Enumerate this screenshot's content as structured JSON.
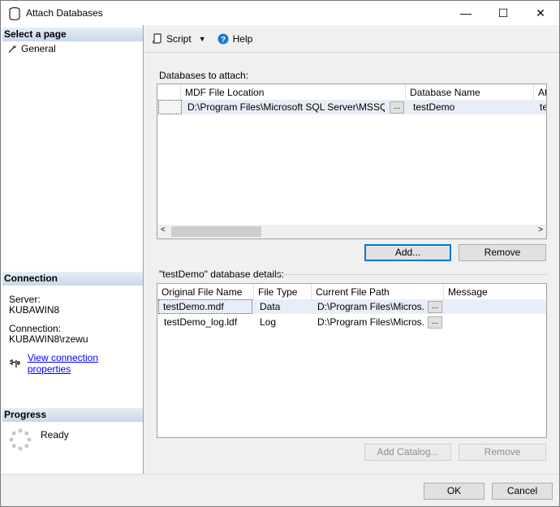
{
  "window": {
    "title": "Attach Databases",
    "minimize": "—",
    "maximize": "☐",
    "close": "✕"
  },
  "left": {
    "select_page_header": "Select a page",
    "pages": [
      {
        "label": "General",
        "icon": "wrench-icon"
      }
    ],
    "connection_header": "Connection",
    "server_label": "Server:",
    "server_value": "KUBAWIN8",
    "connection_label": "Connection:",
    "connection_value": "KUBAWIN8\\rzewu",
    "view_connection_link": "View connection properties",
    "progress_header": "Progress",
    "progress_status": "Ready"
  },
  "toolbar": {
    "script_label": "Script",
    "help_label": "Help"
  },
  "attach": {
    "label": "Databases to attach:",
    "columns": [
      "MDF File Location",
      "Database Name",
      "At"
    ],
    "rows": [
      {
        "mdf": "D:\\Program Files\\Microsoft SQL Server\\MSSQL...",
        "browse": "...",
        "db_name": "testDemo",
        "attach_as": "te"
      }
    ],
    "add_button": "Add...",
    "remove_button": "Remove"
  },
  "details": {
    "label": "\"testDemo\" database details:",
    "columns": [
      "Original File Name",
      "File Type",
      "Current File Path",
      "Message"
    ],
    "rows": [
      {
        "name": "testDemo.mdf",
        "type": "Data",
        "path": "D:\\Program Files\\Micros...",
        "browse": "..."
      },
      {
        "name": "testDemo_log.ldf",
        "type": "Log",
        "path": "D:\\Program Files\\Micros...",
        "browse": "..."
      }
    ],
    "add_catalog_button": "Add Catalog...",
    "remove_button": "Remove"
  },
  "footer": {
    "ok_button": "OK",
    "cancel_button": "Cancel"
  },
  "colors": {
    "accent": "#0078d7",
    "link": "#0000ff",
    "selected_row": "#e8eef7"
  }
}
